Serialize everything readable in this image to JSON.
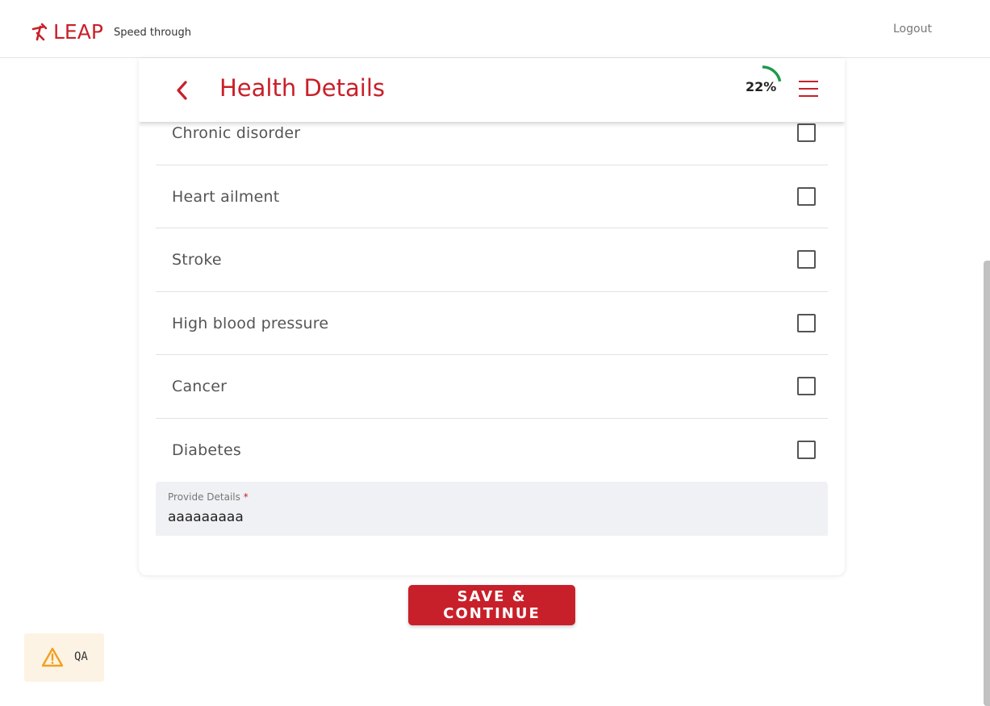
{
  "brand": {
    "name": "LEAP",
    "tagline": "Speed through",
    "color": "#c8202a"
  },
  "header": {
    "logout_label": "Logout"
  },
  "page": {
    "title": "Health Details",
    "back_icon": "chevron-left-icon",
    "menu_icon": "hamburger-menu-icon",
    "progress_text": "22%",
    "progress_value": 0.22,
    "progress_color": "#1a9b4b"
  },
  "conditions": [
    {
      "label": "Chronic disorder",
      "checked": false
    },
    {
      "label": "Heart ailment",
      "checked": false
    },
    {
      "label": "Stroke",
      "checked": false
    },
    {
      "label": "High blood pressure",
      "checked": false
    },
    {
      "label": "Cancer",
      "checked": false
    },
    {
      "label": "Diabetes",
      "checked": false
    }
  ],
  "details": {
    "label": "Provide Details",
    "required_mark": "*",
    "value": "aaaaaaaaa"
  },
  "actions": {
    "save_label": "SAVE & CONTINUE"
  },
  "qa_badge": {
    "icon": "warning-icon",
    "label": "QA",
    "color": "#f0a020"
  }
}
